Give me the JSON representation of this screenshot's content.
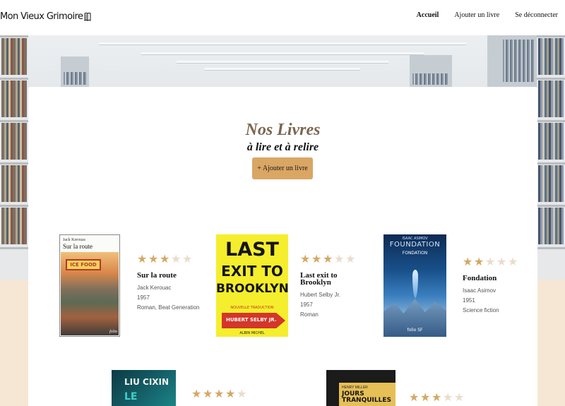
{
  "header": {
    "logo": "Mon Vieux Grimoire",
    "nav": [
      {
        "label": "Accueil",
        "active": true
      },
      {
        "label": "Ajouter un livre",
        "active": false
      },
      {
        "label": "Se déconnecter",
        "active": false
      }
    ]
  },
  "main": {
    "title": "Nos Livres",
    "subtitle": "à lire et à relire",
    "add_button": "+ Ajouter un livre"
  },
  "books": [
    {
      "title": "Sur la route",
      "author": "Jack Kerouac",
      "year": "1957",
      "genre": "Roman, Beat Generation",
      "rating": 3,
      "max_rating": 5,
      "cover": {
        "author": "Jack Kerouac",
        "title": "Sur la route",
        "sign": "ICE FOOD",
        "publisher": "folio"
      }
    },
    {
      "title": "Last exit to Brooklyn",
      "author": "Hubert Selby Jr.",
      "year": "1957",
      "genre": "Roman",
      "rating": 3,
      "max_rating": 5,
      "cover": {
        "line1": "LAST",
        "line2": "EXIT TO",
        "line3": "BROOKLYN",
        "tag": "NOUVELLE TRADUCTION",
        "author": "HUBERT SELBY JR.",
        "publisher": "ALBIN MICHEL"
      }
    },
    {
      "title": "Fondation",
      "author": "Isaac Asimov",
      "year": "1951",
      "genre": "Science fiction",
      "rating": 2,
      "max_rating": 5,
      "cover": {
        "author": "ISAAC ASIMOV",
        "big": "FOUNDATION",
        "small": "FONDATION",
        "publisher": "folio SF"
      }
    },
    {
      "rating": 4,
      "max_rating": 5,
      "cover": {
        "author": "LIU CIXIN",
        "title": "LE"
      }
    },
    {
      "rating": 3,
      "max_rating": 5,
      "cover": {
        "author": "HENRY MILLER",
        "title": "JOURS TRANQUILLES"
      }
    }
  ],
  "colors": {
    "accent": "#d9a664",
    "star_on": "#d4a864",
    "star_off": "#e9dccb",
    "title": "#7a6650",
    "background": "#f5e7d3"
  }
}
